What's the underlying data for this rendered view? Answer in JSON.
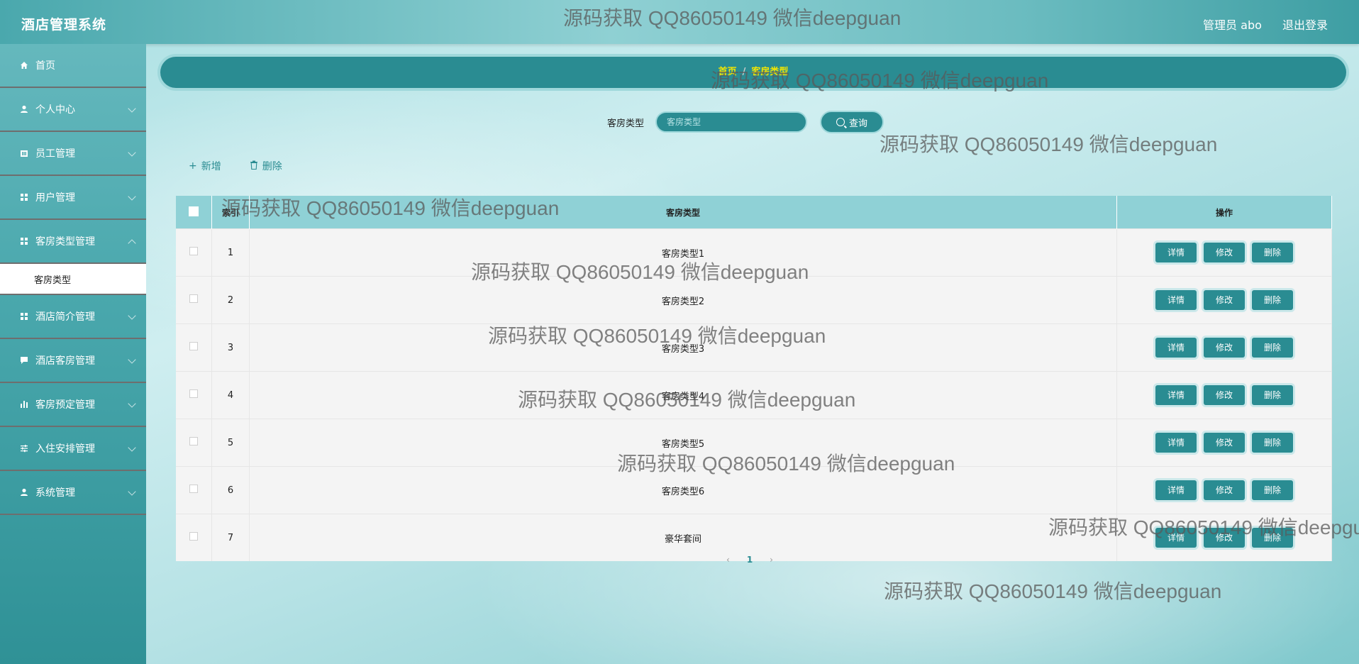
{
  "header": {
    "app_title": "酒店管理系统",
    "user_label": "管理员 abo",
    "logout_label": "退出登录"
  },
  "sidebar": {
    "items": [
      {
        "label": "首页",
        "icon": "home-icon"
      },
      {
        "label": "个人中心",
        "icon": "user-icon"
      },
      {
        "label": "员工管理",
        "icon": "staff-icon"
      },
      {
        "label": "用户管理",
        "icon": "grid-icon"
      },
      {
        "label": "客房类型管理",
        "icon": "grid-icon"
      },
      {
        "label": "客房类型",
        "icon": ""
      },
      {
        "label": "酒店简介管理",
        "icon": "grid-icon"
      },
      {
        "label": "酒店客房管理",
        "icon": "comment-icon"
      },
      {
        "label": "客房预定管理",
        "icon": "chart-icon"
      },
      {
        "label": "入住安排管理",
        "icon": "sliders-icon"
      },
      {
        "label": "系统管理",
        "icon": "user-icon"
      }
    ]
  },
  "breadcrumb": {
    "home": "首页",
    "separator": "/",
    "current": "客房类型"
  },
  "search": {
    "label": "客房类型",
    "placeholder": "客房类型",
    "button_label": "查询"
  },
  "toolbar": {
    "add_label": "新增",
    "delete_label": "删除"
  },
  "table": {
    "headers": {
      "index": "索引",
      "type": "客房类型",
      "ops": "操作"
    },
    "rows": [
      {
        "index": "1",
        "type": "客房类型1"
      },
      {
        "index": "2",
        "type": "客房类型2"
      },
      {
        "index": "3",
        "type": "客房类型3"
      },
      {
        "index": "4",
        "type": "客房类型4"
      },
      {
        "index": "5",
        "type": "客房类型5"
      },
      {
        "index": "6",
        "type": "客房类型6"
      },
      {
        "index": "7",
        "type": "豪华套间"
      }
    ],
    "op_labels": {
      "detail": "详情",
      "edit": "修改",
      "delete": "删除"
    }
  },
  "pagination": {
    "prev": "‹",
    "current": "1",
    "next": "›"
  },
  "watermark": "源码获取 QQ86050149 微信deepguan",
  "colors": {
    "accent": "#2a8c92",
    "header_bg": "#8fd1d6",
    "breadcrumb_text": "#f3e600"
  }
}
